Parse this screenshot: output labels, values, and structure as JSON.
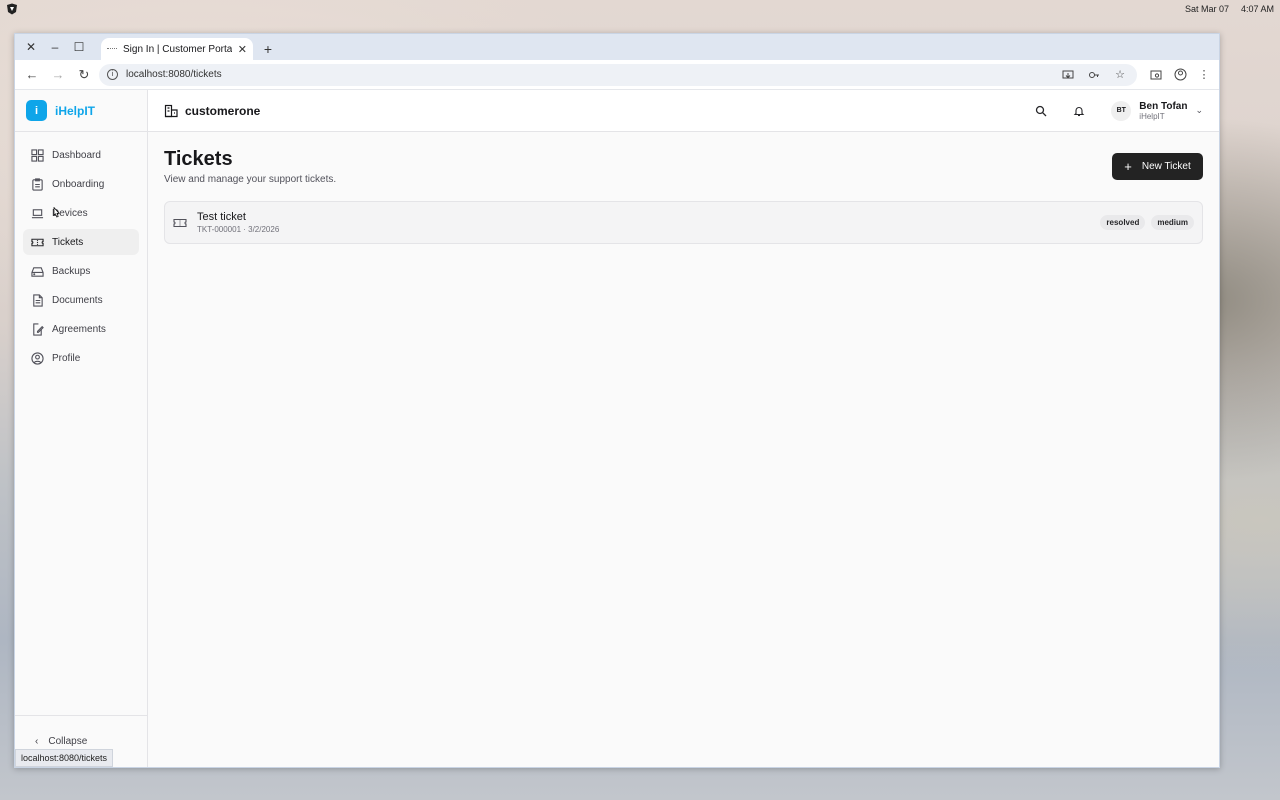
{
  "desktop": {
    "date": "Sat Mar 07",
    "time": "4:07 AM"
  },
  "browser": {
    "tab_title": "Sign In | Customer Portal",
    "url": "localhost:8080/tickets",
    "status_url": "localhost:8080/tickets"
  },
  "app": {
    "brand_letter": "i",
    "brand_name": "iHelpIT",
    "org_name": "customerone",
    "accent_color": "#0ea5e9"
  },
  "sidebar": {
    "items": [
      {
        "label": "Dashboard",
        "icon": "grid-icon"
      },
      {
        "label": "Onboarding",
        "icon": "clipboard-icon"
      },
      {
        "label": "Devices",
        "icon": "laptop-icon"
      },
      {
        "label": "Tickets",
        "icon": "ticket-icon",
        "active": true
      },
      {
        "label": "Backups",
        "icon": "hard-drive-icon"
      },
      {
        "label": "Documents",
        "icon": "file-icon"
      },
      {
        "label": "Agreements",
        "icon": "file-signature-icon"
      },
      {
        "label": "Profile",
        "icon": "user-circle-icon"
      }
    ],
    "collapse_label": "Collapse"
  },
  "user": {
    "initials": "BT",
    "name": "Ben Tofan",
    "org": "iHelpIT"
  },
  "page": {
    "title": "Tickets",
    "subtitle": "View and manage your support tickets.",
    "new_button": "New Ticket"
  },
  "tickets": [
    {
      "title": "Test ticket",
      "meta": "TKT-000001 · 3/2/2026",
      "status": "resolved",
      "priority": "medium"
    }
  ]
}
